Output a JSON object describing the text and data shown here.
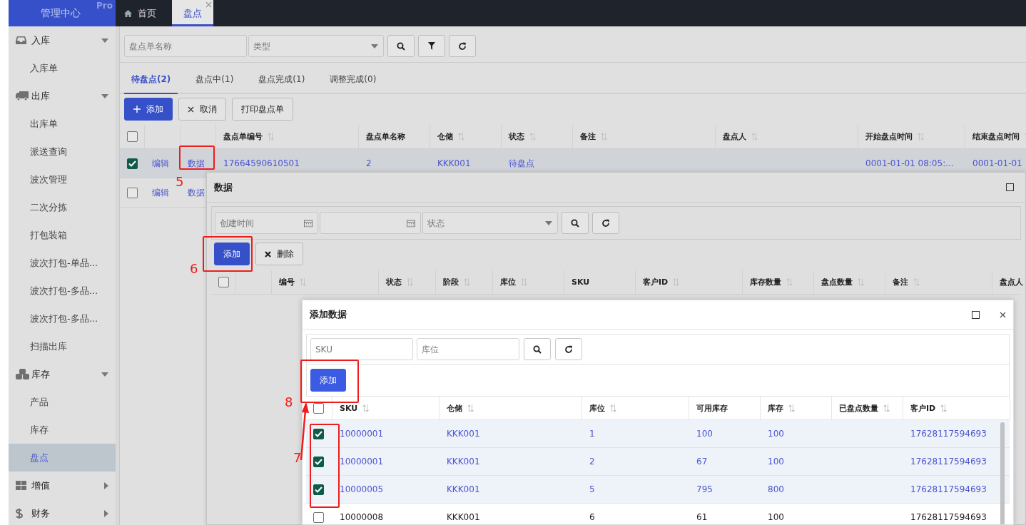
{
  "header": {
    "brand": "管理中心",
    "badge": "Pro",
    "tabs": [
      {
        "label": "首页",
        "selected": false,
        "closable": false
      },
      {
        "label": "盘点",
        "selected": true,
        "closable": true
      }
    ]
  },
  "sidebar": {
    "items": [
      {
        "label": "入库",
        "expanded": true,
        "children": [
          {
            "label": "入库单",
            "selected": false
          }
        ]
      },
      {
        "label": "出库",
        "expanded": true,
        "children": [
          {
            "label": "出库单",
            "selected": false
          },
          {
            "label": "派送查询",
            "selected": false
          },
          {
            "label": "波次管理",
            "selected": false
          },
          {
            "label": "二次分拣",
            "selected": false
          },
          {
            "label": "打包装箱",
            "selected": false
          },
          {
            "label": "波次打包-单品...",
            "selected": false
          },
          {
            "label": "波次打包-多品...",
            "selected": false
          },
          {
            "label": "波次打包-多品...",
            "selected": false
          },
          {
            "label": "扫描出库",
            "selected": false
          }
        ]
      },
      {
        "label": "库存",
        "expanded": true,
        "children": [
          {
            "label": "产品",
            "selected": false
          },
          {
            "label": "库存",
            "selected": false
          },
          {
            "label": "盘点",
            "selected": true
          }
        ]
      },
      {
        "label": "增值",
        "expanded": false
      },
      {
        "label": "财务",
        "expanded": false
      }
    ]
  },
  "main": {
    "filters": [
      {
        "placeholder": "盘点单名称"
      },
      {
        "kind": "select",
        "placeholder": "类型"
      }
    ],
    "tabs": [
      {
        "label": "待盘点(2)",
        "selected": true
      },
      {
        "label": "盘点中(1)",
        "selected": false
      },
      {
        "label": "盘点完成(1)",
        "selected": false
      },
      {
        "label": "调整完成(0)",
        "selected": false
      }
    ],
    "toolbar": [
      {
        "label": "添加",
        "kind": "add"
      },
      {
        "label": "取消",
        "kind": "cancel"
      },
      {
        "label": "打印盘点单",
        "kind": "plain"
      }
    ],
    "table": {
      "all_checked": false,
      "columns": [
        {
          "label": "盘点单编号",
          "sortable": true
        },
        {
          "label": "盘点单名称"
        },
        {
          "label": "仓储",
          "sortable": true
        },
        {
          "label": "状态",
          "sortable": true
        },
        {
          "label": "备注",
          "sortable": true
        },
        {
          "label": "盘点人",
          "sortable": true
        },
        {
          "label": "开始盘点时间",
          "sortable": true
        },
        {
          "label": "结束盘点时间",
          "sortable": true
        }
      ],
      "rows": [
        {
          "selected": true,
          "actions": [
            "编辑",
            "数据"
          ],
          "cells": [
            "17664590610501",
            "2",
            "KKK001",
            "待盘点",
            null,
            null,
            "0001-01-01 08:05:...",
            "0001-01-01"
          ]
        },
        {
          "selected": false,
          "actions": [
            "编辑",
            "数据"
          ]
        }
      ]
    }
  },
  "data_dialog": {
    "title": "数据",
    "filters": [
      {
        "kind": "date",
        "placeholder": "创建时间"
      },
      {
        "kind": "date"
      },
      {
        "kind": "select",
        "placeholder": "状态"
      }
    ],
    "toolbar": [
      {
        "label": "添加",
        "kind": "primary"
      },
      {
        "label": "删除",
        "kind": "delete"
      }
    ],
    "table": {
      "all_checked": false,
      "columns": [
        {
          "label": "编号",
          "sortable": true
        },
        {
          "label": "状态",
          "sortable": true
        },
        {
          "label": "阶段",
          "sortable": true
        },
        {
          "label": "库位",
          "sortable": true
        },
        {
          "label": "SKU"
        },
        {
          "label": "客户ID",
          "sortable": true
        },
        {
          "label": "库存数量",
          "sortable": true
        },
        {
          "label": "盘点数量",
          "sortable": true
        },
        {
          "label": "备注",
          "sortable": true
        },
        {
          "label": "盘点人"
        }
      ]
    }
  },
  "add_dialog": {
    "title": "添加数据",
    "filters": [
      {
        "placeholder": "SKU"
      },
      {
        "placeholder": "库位"
      }
    ],
    "toolbar": [
      {
        "label": "添加",
        "kind": "primary"
      }
    ],
    "table": {
      "all_checked": false,
      "columns": [
        {
          "label": "SKU",
          "sortable": true
        },
        {
          "label": "仓储",
          "sortable": true
        },
        {
          "label": "库位",
          "sortable": true
        },
        {
          "label": "可用库存"
        },
        {
          "label": "库存",
          "sortable": true
        },
        {
          "label": "已盘点数量",
          "sortable": true
        },
        {
          "label": "客户ID",
          "sortable": true
        }
      ],
      "rows": [
        {
          "selected": true,
          "cells": [
            "10000001",
            "KKK001",
            "1",
            "100",
            "100",
            null,
            "17628117594693"
          ]
        },
        {
          "selected": true,
          "cells": [
            "10000001",
            "KKK001",
            "2",
            "67",
            "100",
            null,
            "17628117594693"
          ]
        },
        {
          "selected": true,
          "cells": [
            "10000005",
            "KKK001",
            "5",
            "795",
            "800",
            null,
            "17628117594693"
          ]
        },
        {
          "selected": false,
          "cells": [
            "10000008",
            "KKK001",
            "6",
            "61",
            "100",
            null,
            "17628117594693"
          ]
        }
      ]
    }
  },
  "annotations": [
    {
      "label": "5"
    },
    {
      "label": "6"
    },
    {
      "label": "7"
    },
    {
      "label": "8",
      "arrow": true
    }
  ]
}
